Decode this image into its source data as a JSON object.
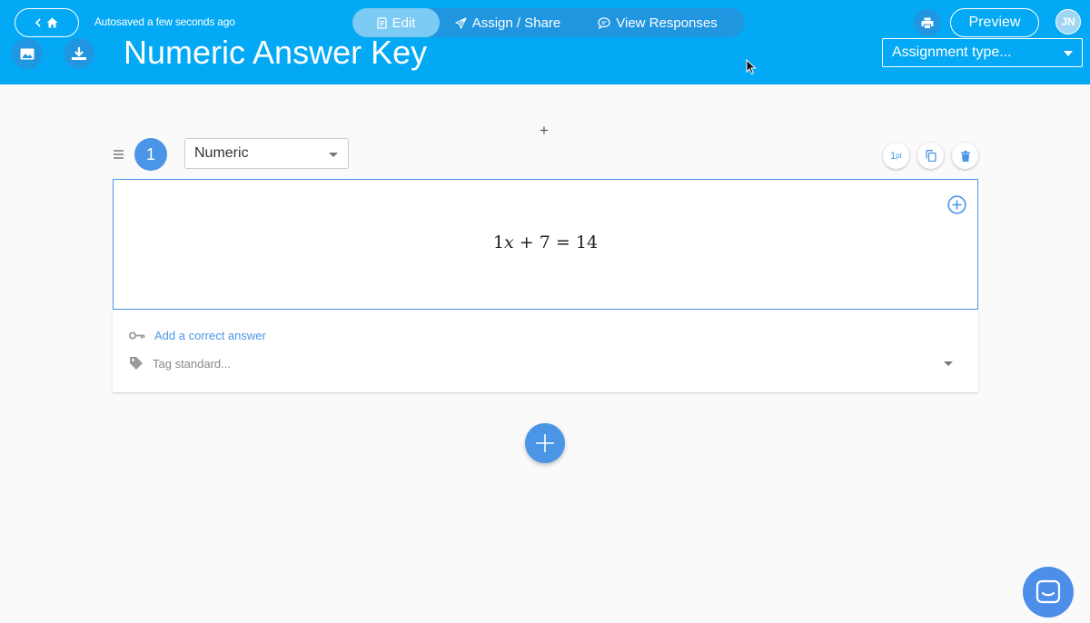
{
  "header": {
    "autosave_text": "Autosaved a few seconds ago",
    "title": "Numeric Answer Key",
    "tabs": [
      {
        "label": "Edit",
        "icon": "document-icon",
        "active": true
      },
      {
        "label": "Assign / Share",
        "icon": "rocket-icon",
        "active": false
      },
      {
        "label": "View Responses",
        "icon": "chat-bubble-icon",
        "active": false
      }
    ],
    "preview_label": "Preview",
    "avatar_initials": "JN",
    "assignment_type_placeholder": "Assignment type...",
    "colors": {
      "background": "#03a9f4",
      "tab_group": "#2196e0",
      "tab_active": "#7ccbf5"
    }
  },
  "question": {
    "number": "1",
    "type": "Numeric",
    "points": "1",
    "points_unit": "pt",
    "equation": {
      "coef": "1",
      "var": "x",
      "op": "+",
      "const": "7",
      "eq": "=",
      "rhs": "14"
    },
    "add_answer_label": "Add a correct answer",
    "tag_placeholder": "Tag standard...",
    "colors": {
      "accent": "#4b95e6",
      "border": "#4b95e6"
    }
  },
  "add_above_symbol": "+"
}
